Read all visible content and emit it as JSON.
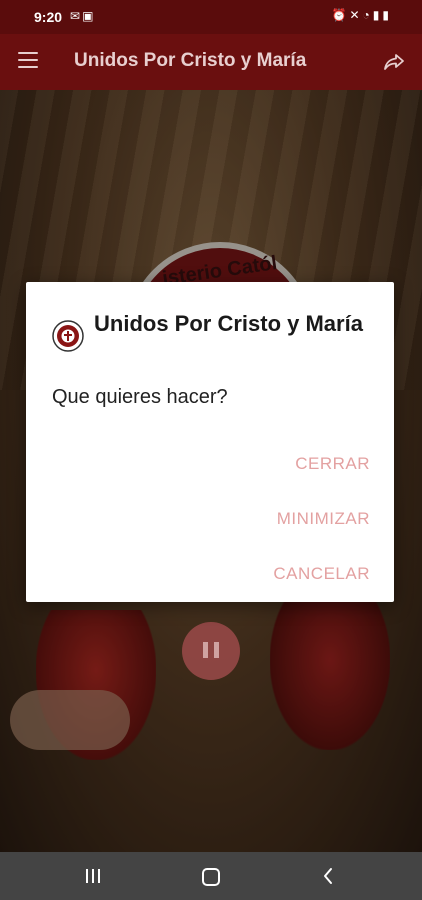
{
  "status_bar": {
    "time": "9:20",
    "left_icons": [
      "mail-icon",
      "image-icon"
    ],
    "right_icons": [
      "alarm-icon",
      "mute-icon",
      "wifi-icon",
      "signal-icon",
      "battery-icon"
    ]
  },
  "app_bar": {
    "title": "Unidos Por Cristo y María",
    "menu_icon": "hamburger-menu-icon",
    "share_icon": "share-icon"
  },
  "background": {
    "seal_text": "isterio Catól"
  },
  "dialog": {
    "title": "Unidos Por Cristo y María",
    "message": "Que quieres hacer?",
    "actions": [
      "CERRAR",
      "MINIMIZAR",
      "CANCELAR"
    ],
    "accent_color": "#e3a1a1"
  },
  "player": {
    "control": "pause-icon"
  },
  "nav_bar": {
    "buttons": [
      "recents-icon",
      "home-icon",
      "back-icon"
    ]
  }
}
